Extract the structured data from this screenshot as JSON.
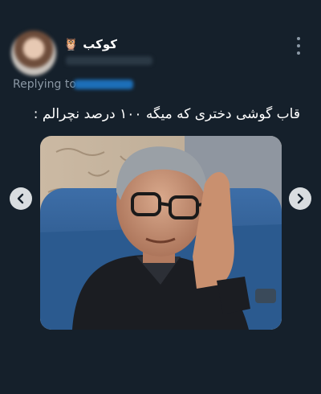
{
  "tweet": {
    "display_name": "کوکب 🦉",
    "replying_label": "Replying to",
    "text": "قاب گوشی دختری که میگه ۱۰۰ درصد نچرالم :"
  },
  "icons": {
    "more": "more-options-icon",
    "prev": "chevron-left-icon",
    "next": "chevron-right-icon"
  },
  "colors": {
    "background": "#15202b",
    "muted_text": "#8b98a5",
    "link": "#1d9bf0"
  }
}
